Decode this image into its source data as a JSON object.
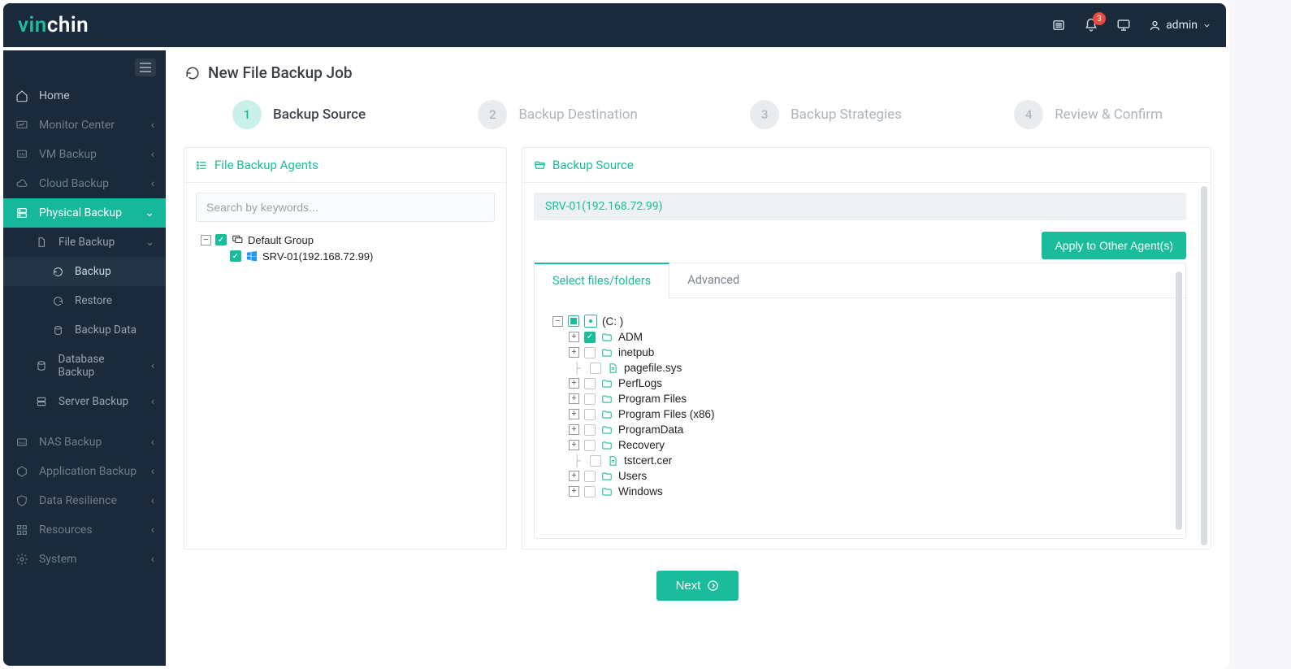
{
  "brand": {
    "first": "vin",
    "rest": "chin"
  },
  "header": {
    "notification_count": "3",
    "user_label": "admin"
  },
  "sidebar": {
    "items": [
      {
        "label": "Home"
      },
      {
        "label": "Monitor Center"
      },
      {
        "label": "VM Backup"
      },
      {
        "label": "Cloud Backup"
      },
      {
        "label": "Physical Backup"
      },
      {
        "label": "NAS Backup"
      },
      {
        "label": "Application Backup"
      },
      {
        "label": "Data Resilience"
      },
      {
        "label": "Resources"
      },
      {
        "label": "System"
      }
    ],
    "physical_children": [
      {
        "label": "File Backup"
      },
      {
        "label": "Database Backup"
      },
      {
        "label": "Server Backup"
      }
    ],
    "file_backup_children": [
      {
        "label": "Backup"
      },
      {
        "label": "Restore"
      },
      {
        "label": "Backup Data"
      }
    ]
  },
  "page": {
    "title": "New File Backup Job"
  },
  "steps": [
    {
      "num": "1",
      "label": "Backup Source"
    },
    {
      "num": "2",
      "label": "Backup Destination"
    },
    {
      "num": "3",
      "label": "Backup Strategies"
    },
    {
      "num": "4",
      "label": "Review & Confirm"
    }
  ],
  "agents_panel": {
    "title": "File Backup Agents",
    "search_placeholder": "Search by keywords...",
    "group_label": "Default Group",
    "host_label": "SRV-01(192.168.72.99)"
  },
  "source_panel": {
    "title": "Backup Source",
    "host_header": "SRV-01(192.168.72.99)",
    "apply_button": "Apply to Other Agent(s)",
    "tabs": {
      "select": "Select files/folders",
      "advanced": "Advanced"
    },
    "drive_label": "(C: )",
    "items": [
      {
        "name": "ADM",
        "type": "folder",
        "checked": true,
        "expandable": true
      },
      {
        "name": "inetpub",
        "type": "folder",
        "checked": false,
        "expandable": true
      },
      {
        "name": "pagefile.sys",
        "type": "file",
        "checked": false,
        "expandable": false
      },
      {
        "name": "PerfLogs",
        "type": "folder",
        "checked": false,
        "expandable": true
      },
      {
        "name": "Program Files",
        "type": "folder",
        "checked": false,
        "expandable": true
      },
      {
        "name": "Program Files (x86)",
        "type": "folder",
        "checked": false,
        "expandable": true
      },
      {
        "name": "ProgramData",
        "type": "folder",
        "checked": false,
        "expandable": true
      },
      {
        "name": "Recovery",
        "type": "folder",
        "checked": false,
        "expandable": true
      },
      {
        "name": "tstcert.cer",
        "type": "file",
        "checked": false,
        "expandable": false
      },
      {
        "name": "Users",
        "type": "folder",
        "checked": false,
        "expandable": true
      },
      {
        "name": "Windows",
        "type": "folder",
        "checked": false,
        "expandable": true
      }
    ]
  },
  "footer": {
    "next": "Next"
  }
}
